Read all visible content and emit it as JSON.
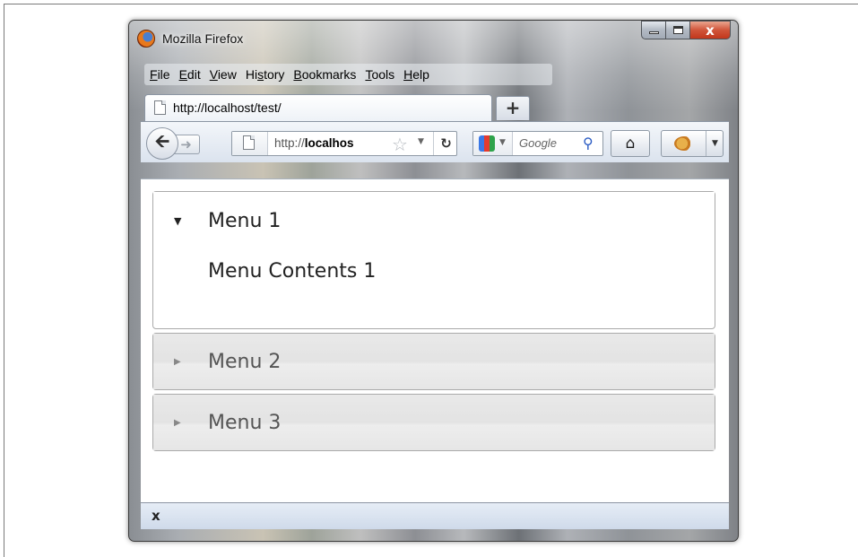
{
  "window": {
    "title": "Mozilla Firefox",
    "controls": {
      "minimize": "minimize",
      "maximize": "maximize",
      "close": "x"
    }
  },
  "menubar": {
    "items": [
      {
        "pre": "",
        "u": "F",
        "post": "ile"
      },
      {
        "pre": "",
        "u": "E",
        "post": "dit"
      },
      {
        "pre": "",
        "u": "V",
        "post": "iew"
      },
      {
        "pre": "Hi",
        "u": "s",
        "post": "tory"
      },
      {
        "pre": "",
        "u": "B",
        "post": "ookmarks"
      },
      {
        "pre": "",
        "u": "T",
        "post": "ools"
      },
      {
        "pre": "",
        "u": "H",
        "post": "elp"
      }
    ]
  },
  "tabs": [
    {
      "title": "http://localhost/test/"
    }
  ],
  "newtab": {
    "label": "+"
  },
  "navbar": {
    "url_prefix": "http://",
    "url_host": "localhos",
    "search_placeholder": "Google",
    "back_icon": "back-arrow-icon",
    "forward_icon": "forward-arrow-icon",
    "reload_icon": "reload-icon",
    "home_icon": "home-icon"
  },
  "accordion": {
    "panels": [
      {
        "title": "Menu 1",
        "content": "Menu Contents 1",
        "state": "expanded"
      },
      {
        "title": "Menu 2",
        "content": "",
        "state": "collapsed"
      },
      {
        "title": "Menu 3",
        "content": "",
        "state": "collapsed"
      }
    ]
  },
  "statusbar": {
    "close_label": "x"
  },
  "colors": {
    "accordion_border": "#aaaaaa",
    "collapsed_header_bg": "#e6e6e6",
    "active_header_bg": "#ffffff",
    "close_button": "#c2371c"
  }
}
